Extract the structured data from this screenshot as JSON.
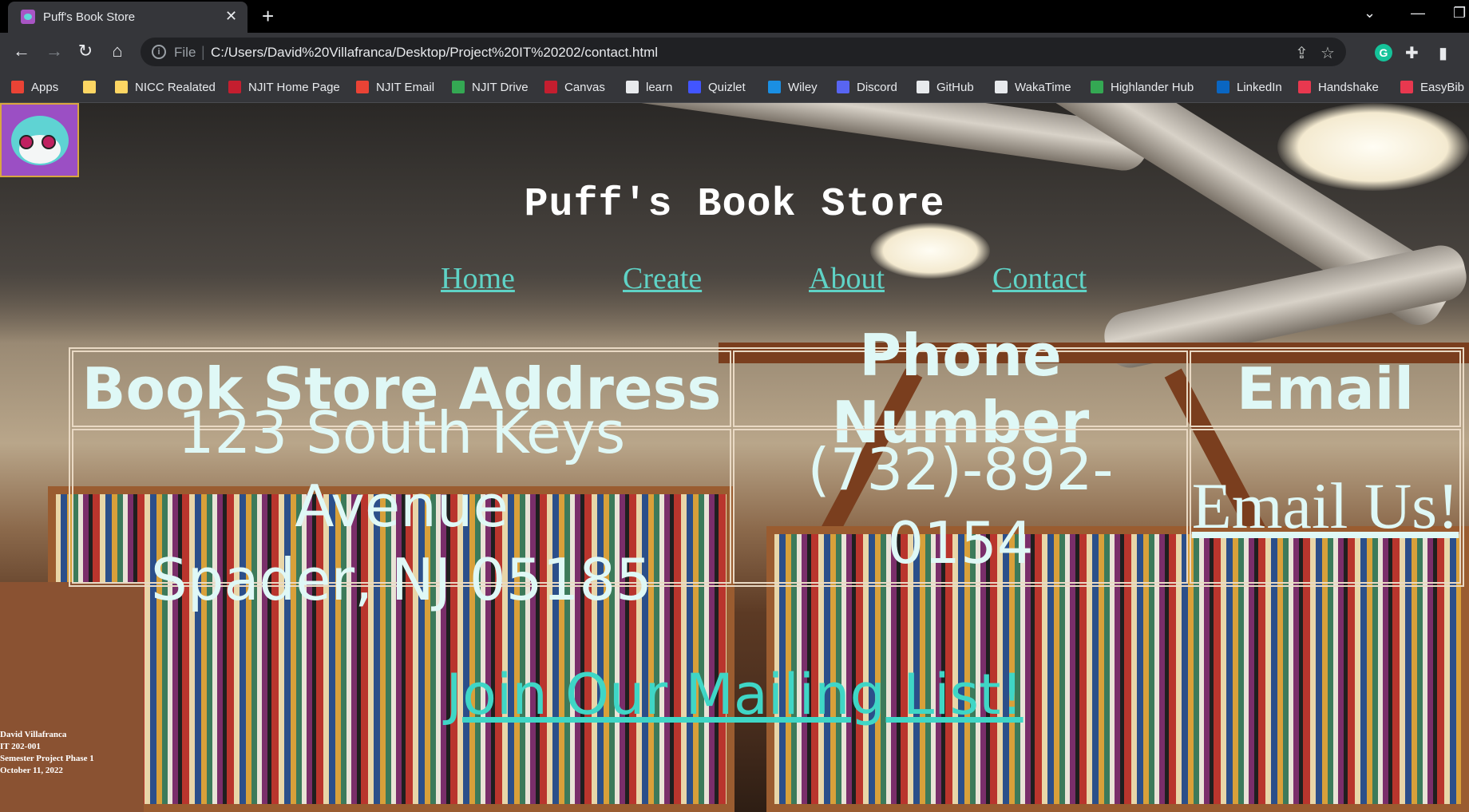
{
  "browser": {
    "tab_title": "Puff's Book Store",
    "url_scheme": "File",
    "url": "C:/Users/David%20Villafranca/Desktop/Project%20IT%20202/contact.html"
  },
  "bookmarks": [
    {
      "label": "Apps",
      "icon": "apps-grid-icon",
      "color": "#ea4335"
    },
    {
      "label": "",
      "icon": "folder-icon",
      "color": "#fdd663"
    },
    {
      "label": "NICC Realated",
      "icon": "folder-icon",
      "color": "#fdd663"
    },
    {
      "label": "NJIT Home Page",
      "icon": "njit-icon",
      "color": "#c41e2f"
    },
    {
      "label": "NJIT Email",
      "icon": "gmail-icon",
      "color": "#ea4335"
    },
    {
      "label": "NJIT Drive",
      "icon": "drive-icon",
      "color": "#34a853"
    },
    {
      "label": "Canvas",
      "icon": "njit-icon",
      "color": "#c41e2f"
    },
    {
      "label": "learn",
      "icon": "learn-icon",
      "color": "#e8eaed"
    },
    {
      "label": "Quizlet",
      "icon": "quizlet-icon",
      "color": "#4255ff"
    },
    {
      "label": "Wiley",
      "icon": "wiley-icon",
      "color": "#1a8fe3"
    },
    {
      "label": "Discord",
      "icon": "discord-icon",
      "color": "#5865f2"
    },
    {
      "label": "GitHub",
      "icon": "github-icon",
      "color": "#e8eaed"
    },
    {
      "label": "WakaTime",
      "icon": "wakatime-icon",
      "color": "#e8eaed"
    },
    {
      "label": "Highlander Hub",
      "icon": "highlander-icon",
      "color": "#34a853"
    },
    {
      "label": "LinkedIn",
      "icon": "linkedin-icon",
      "color": "#0a66c2"
    },
    {
      "label": "Handshake",
      "icon": "handshake-icon",
      "color": "#e8384f"
    },
    {
      "label": "EasyBib",
      "icon": "easybib-icon",
      "color": "#e8384f"
    }
  ],
  "site": {
    "title": "Puff's Book Store",
    "nav": [
      "Home",
      "Create",
      "About",
      "Contact"
    ]
  },
  "contact_table": {
    "headers": [
      "Book Store Address",
      "Phone Number",
      "Email"
    ],
    "address_line1": "123 South Keys Avenue",
    "address_line2": "Spader, NJ 05185",
    "phone": "(732)-892-0154",
    "email_link": "Email Us!"
  },
  "mailing_link": "Join Our Mailing List!",
  "footer": [
    "David Villafranca",
    "IT 202-001",
    "Semester Project Phase 1",
    "October 11, 2022"
  ],
  "colors": {
    "link": "#5fd3c6",
    "text_light": "#dff8f6",
    "table_border": "#e9d9c4"
  }
}
